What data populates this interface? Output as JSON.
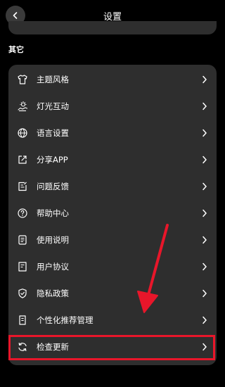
{
  "header": {
    "title": "设置"
  },
  "section": {
    "label": "其它"
  },
  "menu": {
    "items": [
      {
        "label": "主题风格",
        "icon": "tshirt-icon"
      },
      {
        "label": "灯光互动",
        "icon": "light-interaction-icon"
      },
      {
        "label": "语言设置",
        "icon": "globe-icon"
      },
      {
        "label": "分享APP",
        "icon": "share-icon"
      },
      {
        "label": "问题反馈",
        "icon": "feedback-icon"
      },
      {
        "label": "帮助中心",
        "icon": "help-icon"
      },
      {
        "label": "使用说明",
        "icon": "manual-icon"
      },
      {
        "label": "用户协议",
        "icon": "user-agreement-icon"
      },
      {
        "label": "隐私政策",
        "icon": "shield-icon"
      },
      {
        "label": "个性化推荐管理",
        "icon": "recommendation-icon"
      },
      {
        "label": "检查更新",
        "icon": "refresh-icon"
      }
    ]
  },
  "colors": {
    "background": "#000000",
    "card": "#2e2e2e",
    "annotation": "#e8162a"
  }
}
